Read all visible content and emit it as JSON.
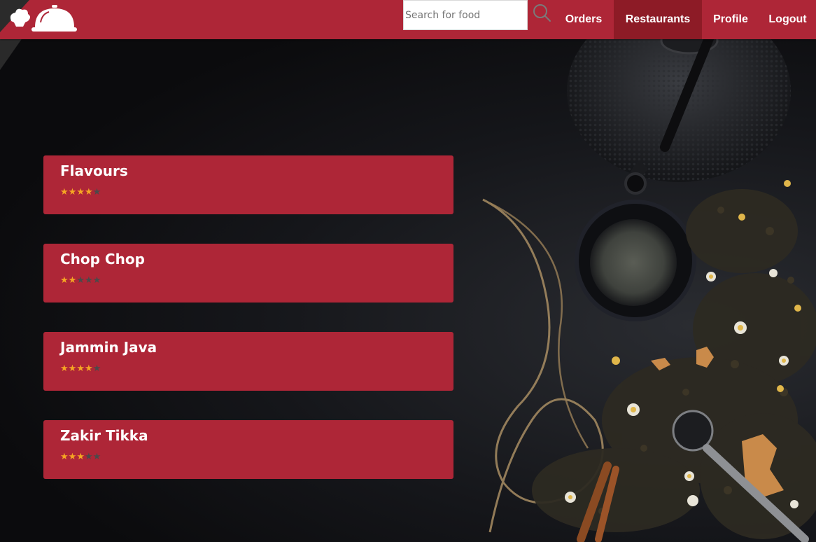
{
  "navbar": {
    "search_placeholder": "Search for food",
    "items": [
      {
        "label": "Orders",
        "active": false
      },
      {
        "label": "Restaurants",
        "active": true
      },
      {
        "label": "Profile",
        "active": false
      },
      {
        "label": "Logout",
        "active": false
      }
    ],
    "icons": {
      "logo": "cloche-logo-icon",
      "search": "search-icon"
    }
  },
  "restaurants": [
    {
      "name": "Flavours",
      "rating": 4,
      "max_rating": 5
    },
    {
      "name": "Chop Chop",
      "rating": 2,
      "max_rating": 5
    },
    {
      "name": "Jammin Java",
      "rating": 4,
      "max_rating": 5
    },
    {
      "name": "Zakir Tikka",
      "rating": 3,
      "max_rating": 5
    }
  ],
  "colors": {
    "brand_red": "#ae2637",
    "active_nav": "#8d1b26",
    "star_filled": "#f5a623",
    "star_empty": "#4a4a4a"
  }
}
